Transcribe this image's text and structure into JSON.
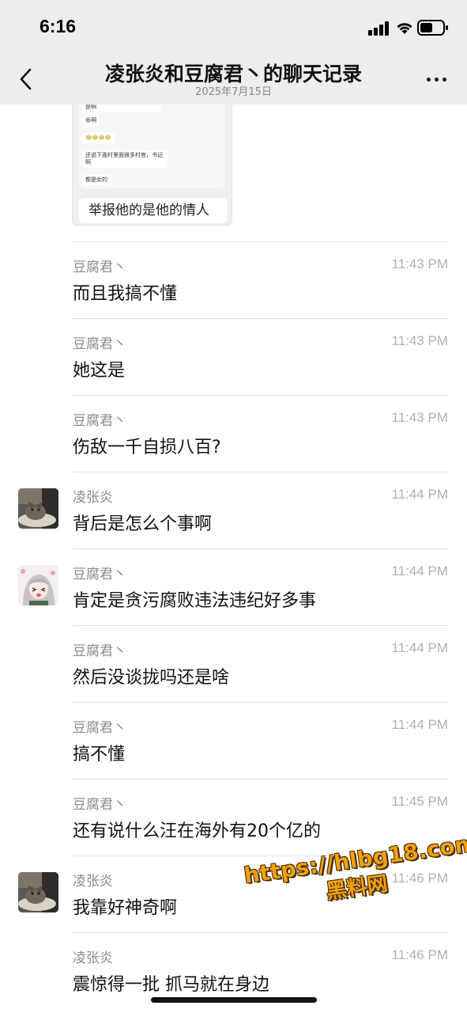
{
  "status_bar": {
    "time": "6:16"
  },
  "nav": {
    "title": "凌张炎和豆腐君丶的聊天记录",
    "subtitle": "2025年7月15日"
  },
  "quote_card": {
    "lines": [
      "是啊",
      "😆啊",
      "😂😂😂😂",
      "还说下面村里面很多村官，书记啊",
      "都是女的"
    ],
    "caption": "举报他的是他的情人"
  },
  "messages": [
    {
      "sender": "豆腐君丶",
      "time": "11:43 PM",
      "content": "而且我搞不懂",
      "avatar": ""
    },
    {
      "sender": "豆腐君丶",
      "time": "11:43 PM",
      "content": "她这是",
      "avatar": ""
    },
    {
      "sender": "豆腐君丶",
      "time": "11:43 PM",
      "content": "伤敌一千自损八百?",
      "avatar": ""
    },
    {
      "sender": "凌张炎",
      "time": "11:44 PM",
      "content": "背后是怎么个事啊",
      "avatar": "cat"
    },
    {
      "sender": "豆腐君丶",
      "time": "11:44 PM",
      "content": "肯定是贪污腐败违法违纪好多事",
      "avatar": "anime"
    },
    {
      "sender": "豆腐君丶",
      "time": "11:44 PM",
      "content": "然后没谈拢吗还是啥",
      "avatar": ""
    },
    {
      "sender": "豆腐君丶",
      "time": "11:44 PM",
      "content": "搞不懂",
      "avatar": ""
    },
    {
      "sender": "豆腐君丶",
      "time": "11:45 PM",
      "content": "还有说什么汪在海外有20个亿的",
      "avatar": ""
    },
    {
      "sender": "凌张炎",
      "time": "11:46 PM",
      "content": "我靠好神奇啊",
      "avatar": "cat"
    },
    {
      "sender": "凌张炎",
      "time": "11:46 PM",
      "content": "震惊得一批 抓马就在身边",
      "avatar": ""
    }
  ],
  "watermark": {
    "url": "https://hlbg18.com",
    "name": "黑料网"
  },
  "colors": {
    "nav_bg": "#ededed",
    "watermark": "#f2a20f"
  }
}
